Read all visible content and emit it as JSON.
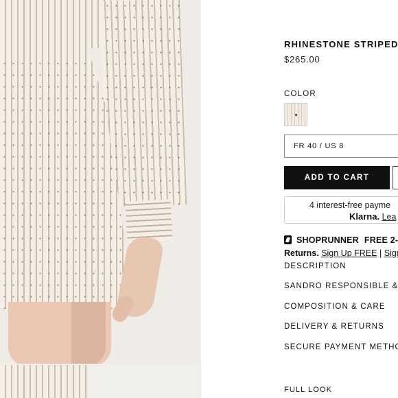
{
  "product": {
    "title": "RHINESTONE STRIPED P",
    "price": "$265.00"
  },
  "color": {
    "label": "COLOR"
  },
  "size_select": {
    "value": "FR 40 / US 8"
  },
  "cart": {
    "button_label": "ADD TO CART"
  },
  "klarna": {
    "line1": "4 interest-free payme",
    "logo": "Klarna.",
    "link": "Lea"
  },
  "shoprunner": {
    "brand": "SHOPRUNNER",
    "offer": "FREE 2-",
    "returns_bold": "Returns.",
    "signup": "Sign Up FREE",
    "separator": "|",
    "signin": "Sign"
  },
  "accordion": {
    "description": "DESCRIPTION",
    "responsible": "SANDRO RESPONSIBLE & SU",
    "composition": "COMPOSITION & CARE",
    "delivery": "DELIVERY & RETURNS",
    "secure": "SECURE PAYMENT METHODS"
  },
  "full_look": {
    "label": "FULL LOOK"
  },
  "colors": {
    "button_bg": "#111111",
    "border": "#8c8c8c",
    "fabric": "#f3ece2",
    "stripe": "#c7beb0"
  },
  "icons": {
    "shoprunner": "shoprunner-icon"
  }
}
